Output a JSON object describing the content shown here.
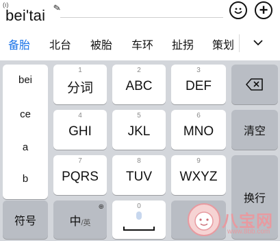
{
  "composition": {
    "text": "bei'tai",
    "cursor_glyph": "(ı)",
    "pencil_glyph": "✎"
  },
  "top_buttons": {
    "emoji_glyph": "☺",
    "plus_glyph": "+"
  },
  "candidates": [
    {
      "text": "备胎",
      "active": true
    },
    {
      "text": "北台",
      "active": false
    },
    {
      "text": "被胎",
      "active": false
    },
    {
      "text": "车环",
      "active": false
    },
    {
      "text": "扯拐",
      "active": false
    },
    {
      "text": "策划",
      "active": false
    }
  ],
  "pinyin_options": [
    "bei",
    "ce",
    "a",
    "b"
  ],
  "keys": {
    "k1": {
      "num": "1",
      "label": "分词"
    },
    "k2": {
      "num": "2",
      "label": "ABC"
    },
    "k3": {
      "num": "3",
      "label": "DEF"
    },
    "k4": {
      "num": "4",
      "label": "GHI"
    },
    "k5": {
      "num": "5",
      "label": "JKL"
    },
    "k6": {
      "num": "6",
      "label": "MNO"
    },
    "k7": {
      "num": "7",
      "label": "PQRS"
    },
    "k8": {
      "num": "8",
      "label": "TUV"
    },
    "k9": {
      "num": "9",
      "label": "WXYZ"
    },
    "k0": {
      "num": "0",
      "label": ""
    }
  },
  "function_keys": {
    "clear": "清空",
    "enter": "换行",
    "symbol": "符号",
    "lang_main": "中",
    "lang_alt": "/英",
    "globe_glyph": "⊕",
    "backspace_glyph": "⌫"
  },
  "watermark": {
    "text": "八宝网",
    "url": "www.8bb.com"
  },
  "colors": {
    "active_candidate": "#1a73e8",
    "keyboard_bg": "#d3d6db",
    "dark_key": "#b9bdc4",
    "watermark": "#e89aa0"
  }
}
